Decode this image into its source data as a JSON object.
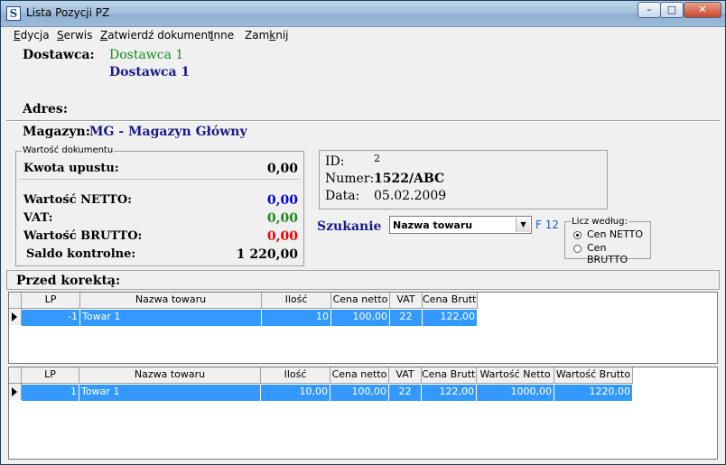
{
  "window": {
    "title": "Lista Pozycji PZ",
    "btn_min": "–",
    "btn_max": "□",
    "btn_close": "✕"
  },
  "menu": [
    {
      "pre": "",
      "u": "E",
      "post": "dycja"
    },
    {
      "pre": "",
      "u": "S",
      "post": "erwis"
    },
    {
      "pre": "",
      "u": "Z",
      "post": "atwierdź dokument"
    },
    {
      "pre": "",
      "u": "I",
      "post": "nne"
    },
    {
      "pre": "Zam",
      "u": "k",
      "post": "nij"
    }
  ],
  "supplier": {
    "label": "Dostawca:",
    "name_green": "Dostawca 1",
    "name_blue": "Dostawca 1"
  },
  "address": {
    "label": "Adres:"
  },
  "warehouse": {
    "label": "Magazyn:",
    "value": "MG - Magazyn Główny"
  },
  "doc_value": {
    "group_title": "Wartość dokumentu",
    "discount_label": "Kwota upustu:",
    "discount_value": "0,00",
    "netto_label": "Wartość NETTO:",
    "netto_value": "0,00",
    "vat_label": "VAT:",
    "vat_value": "0,00",
    "brutto_label": "Wartość BRUTTO:",
    "brutto_value": "0,00",
    "saldo_label": "Saldo kontrolne:",
    "saldo_value": "1 220,00"
  },
  "info": {
    "id_label": "ID:",
    "id_value": "2",
    "number_label": "Numer:",
    "number_value": "1522/ABC",
    "date_label": "Data:",
    "date_value": "05.02.2009"
  },
  "search": {
    "label": "Szukanie",
    "selected": "Nazwa towaru",
    "hotkey": "F 12"
  },
  "calc": {
    "title": "Licz według:",
    "opt1": "Cen NETTO",
    "opt2": "Cen BRUTTO",
    "selected": "Cen NETTO"
  },
  "section": {
    "before_correction": "Przed korektą:"
  },
  "table1": {
    "headers": [
      "LP",
      "Nazwa towaru",
      "Ilość",
      "Cena netto",
      "VAT",
      "Cena Brutto"
    ],
    "rows": [
      [
        "-1",
        "Towar 1",
        "10",
        "100,00",
        "22",
        "122,00"
      ]
    ]
  },
  "table2": {
    "headers": [
      "LP",
      "Nazwa towaru",
      "Ilość",
      "Cena netto",
      "VAT",
      "Cena Brutto",
      "Wartość Netto",
      "Wartość Brutto"
    ],
    "rows": [
      [
        "1",
        "Towar 1",
        "10,00",
        "100,00",
        "22",
        "122,00",
        "1000,00",
        "1220,00"
      ]
    ]
  },
  "colors": {
    "green": "#1a8a1a",
    "navy": "#1a1a8c",
    "blue": "#0000ee",
    "red": "#ee0000",
    "selection": "#3399ff"
  }
}
